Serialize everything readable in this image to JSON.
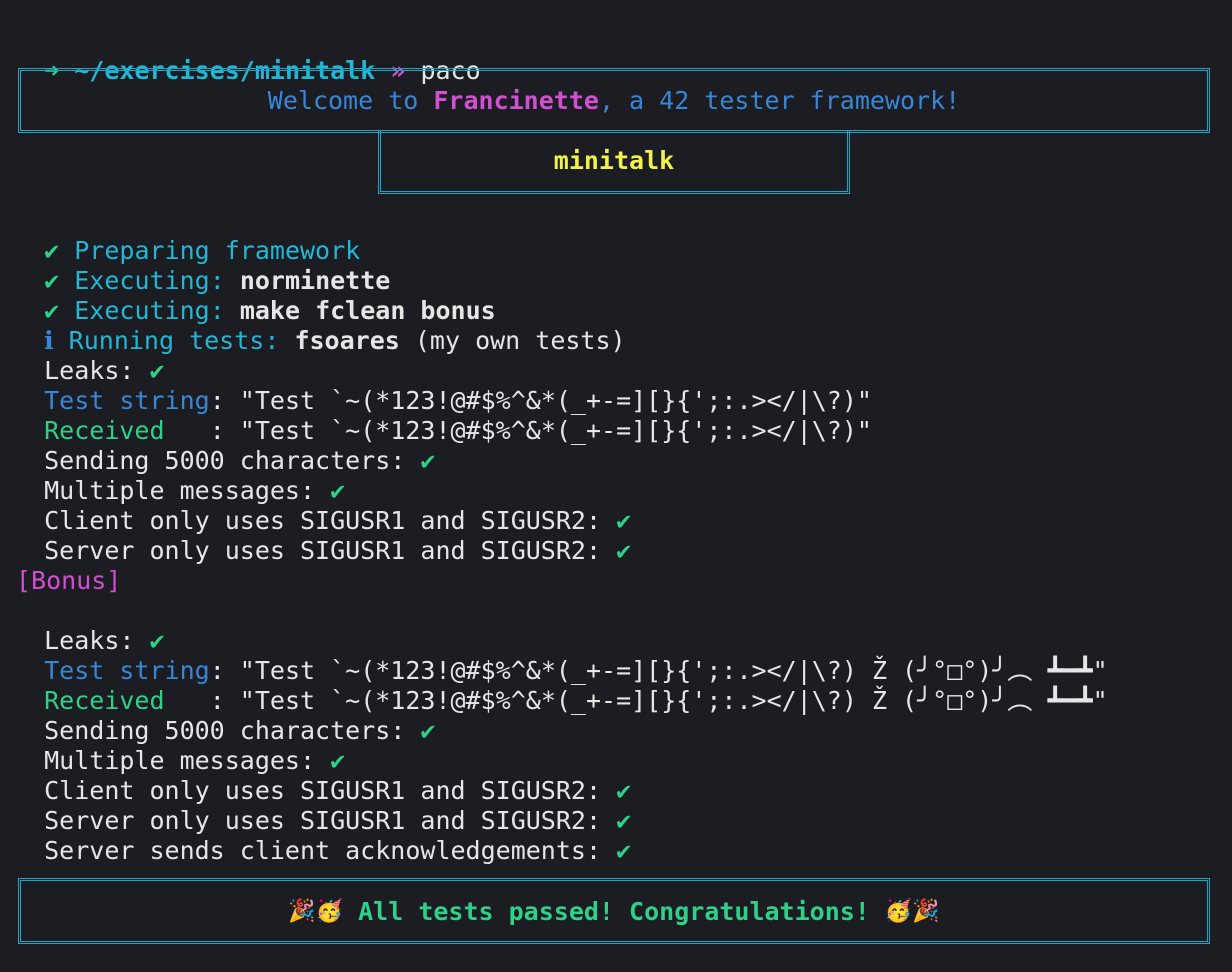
{
  "prompt": {
    "arrow": "➜",
    "path": "~/exercises/minitalk",
    "separator": "»",
    "command": "paco"
  },
  "banner": {
    "welcome_prefix": "Welcome to ",
    "brand": "Francinette",
    "welcome_suffix": ", a 42 tester framework!"
  },
  "project_name": "minitalk",
  "steps": [
    {
      "mark": "✔",
      "label": "Preparing framework",
      "value": ""
    },
    {
      "mark": "✔",
      "label": "Executing: ",
      "value": "norminette"
    },
    {
      "mark": "✔",
      "label": "Executing: ",
      "value": "make fclean bonus"
    },
    {
      "mark": "ℹ",
      "label": "Running tests: ",
      "value": "fsoares",
      "note": " (my own tests)"
    }
  ],
  "mandatory": {
    "leaks_label": "Leaks: ",
    "test_string_label": "Test string",
    "test_string_value": ": \"Test `~(*123!@#$%^&*(_+-=][}{';:.></|\\?)\"",
    "received_label": "Received   ",
    "received_value": ": \"Test `~(*123!@#$%^&*(_+-=][}{';:.></|\\?)\"",
    "checks": [
      "Sending 5000 characters: ",
      "Multiple messages: ",
      "Client only uses SIGUSR1 and SIGUSR2: ",
      "Server only uses SIGUSR1 and SIGUSR2: "
    ]
  },
  "bonus": {
    "header": "[Bonus]",
    "leaks_label": "Leaks: ",
    "test_string_label": "Test string",
    "test_string_value": ": \"Test `~(*123!@#$%^&*(_+-=][}{';:.></|\\?) Ž (╯°□°)╯︵ ┻━┻\"",
    "received_label": "Received   ",
    "received_value": ": \"Test `~(*123!@#$%^&*(_+-=][}{';:.></|\\?) Ž (╯°□°)╯︵ ┻━┻\"",
    "checks": [
      "Sending 5000 characters: ",
      "Multiple messages: ",
      "Client only uses SIGUSR1 and SIGUSR2: ",
      "Server only uses SIGUSR1 and SIGUSR2: ",
      "Server sends client acknowledgements: "
    ]
  },
  "check_mark": "✔",
  "footer": {
    "emoji_left": "🎉🥳",
    "message": " All tests passed! Congratulations! ",
    "emoji_right": "🥳🎉"
  },
  "colors": {
    "background": "#1b1d22",
    "green": "#2fd189",
    "cyan": "#23b6d6",
    "blue": "#3a86d6",
    "magenta": "#d14fd0",
    "yellow": "#f2f24a",
    "border": "#19a7c6"
  }
}
